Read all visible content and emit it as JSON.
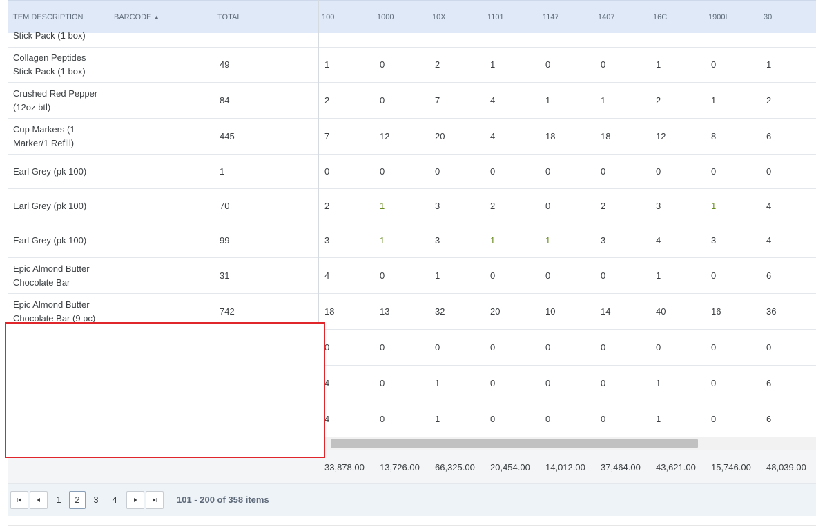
{
  "header": {
    "item_description": "ITEM DESCRIPTION",
    "barcode": "BARCODE",
    "barcode_sort": "▲",
    "total": "TOTAL",
    "columns": [
      "100",
      "1000",
      "10X",
      "1101",
      "1147",
      "1407",
      "16C",
      "1900L",
      "30"
    ]
  },
  "rows": [
    {
      "desc": [
        "Stick Pack (1 box)"
      ],
      "total": "",
      "values": [
        "",
        "",
        "",
        "",
        "",
        "",
        "",
        "",
        ""
      ]
    },
    {
      "desc": [
        "Collagen Peptides",
        "Stick Pack (1 box)"
      ],
      "total": "49",
      "values": [
        "1",
        "0",
        "2",
        "1",
        "0",
        "0",
        "1",
        "0",
        "1"
      ]
    },
    {
      "desc": [
        "Crushed Red Pepper",
        "(12oz btl)"
      ],
      "total": "84",
      "values": [
        "2",
        "0",
        "7",
        "4",
        "1",
        "1",
        "2",
        "1",
        "2"
      ]
    },
    {
      "desc": [
        "Cup Markers (1",
        "Marker/1 Refill)"
      ],
      "total": "445",
      "values": [
        "7",
        "12",
        "20",
        "4",
        "18",
        "18",
        "12",
        "8",
        "6"
      ]
    },
    {
      "desc": [
        "Earl Grey (pk 100)"
      ],
      "total": "1",
      "values": [
        "0",
        "0",
        "0",
        "0",
        "0",
        "0",
        "0",
        "0",
        "0"
      ]
    },
    {
      "desc": [
        "Earl Grey (pk 100)"
      ],
      "total": "70",
      "values": [
        "2",
        "1",
        "3",
        "2",
        "0",
        "2",
        "3",
        "1",
        "4"
      ]
    },
    {
      "desc": [
        "Earl Grey (pk 100)"
      ],
      "total": "99",
      "values": [
        "3",
        "1",
        "3",
        "1",
        "1",
        "3",
        "4",
        "3",
        "4"
      ]
    },
    {
      "desc": [
        "Epic Almond Butter",
        "Chocolate Bar"
      ],
      "total": "31",
      "values": [
        "4",
        "0",
        "1",
        "0",
        "0",
        "0",
        "1",
        "0",
        "6"
      ]
    },
    {
      "desc": [
        "Epic Almond Butter",
        "Chocolate Bar (9 pc)"
      ],
      "total": "742",
      "values": [
        "18",
        "13",
        "32",
        "20",
        "10",
        "14",
        "40",
        "16",
        "36"
      ]
    },
    {
      "desc": [],
      "total": "",
      "values": [
        "0",
        "0",
        "0",
        "0",
        "0",
        "0",
        "0",
        "0",
        "0"
      ]
    },
    {
      "desc": [],
      "total": "",
      "values": [
        "4",
        "0",
        "1",
        "0",
        "0",
        "0",
        "1",
        "0",
        "6"
      ]
    },
    {
      "desc": [],
      "total": "",
      "values": [
        "4",
        "0",
        "1",
        "0",
        "0",
        "0",
        "1",
        "0",
        "6"
      ]
    }
  ],
  "totals": [
    "33,878.00",
    "13,726.00",
    "66,325.00",
    "20,454.00",
    "14,012.00",
    "37,464.00",
    "43,621.00",
    "15,746.00",
    "48,039.00"
  ],
  "pager": {
    "pages": [
      "1",
      "2",
      "3",
      "4"
    ],
    "current": "2",
    "info": "101 - 200 of 358 items"
  },
  "colors": {
    "header_bg": "#dfe9f7",
    "annotation": "#e0262b",
    "accent_value": "#6b8e23"
  }
}
